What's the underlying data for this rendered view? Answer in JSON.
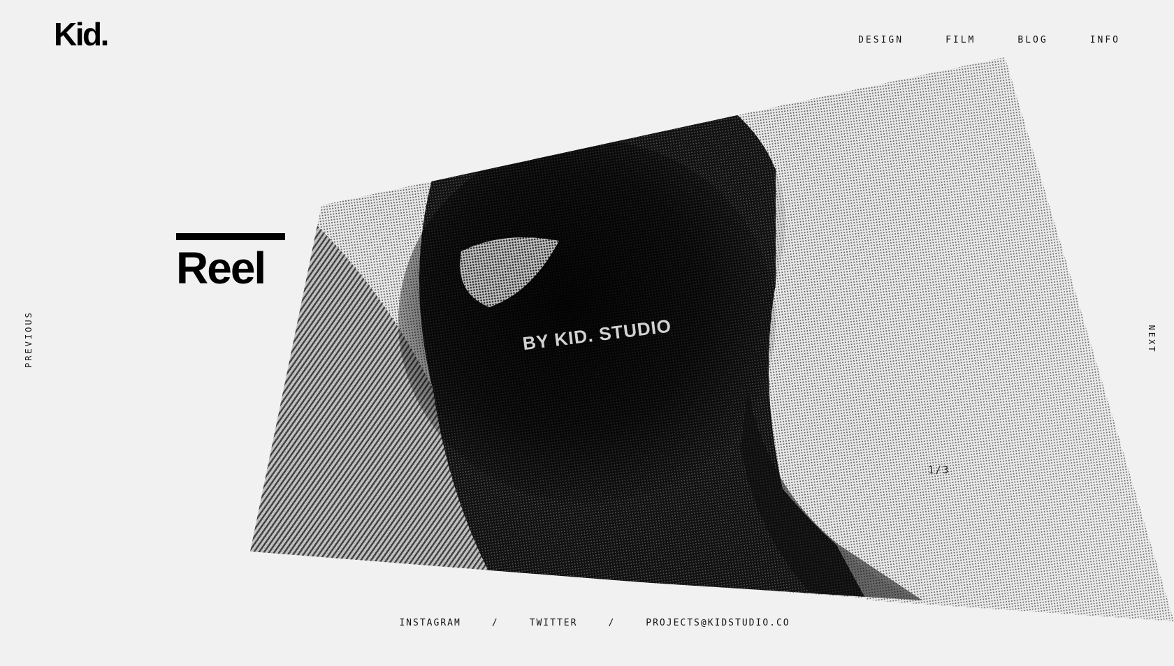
{
  "brand": {
    "logo": "Kid."
  },
  "nav": {
    "items": [
      "DESIGN",
      "FILM",
      "BLOG",
      "INFO"
    ]
  },
  "side": {
    "previous": "PREVIOUS",
    "next": "NEXT"
  },
  "hero": {
    "title": "Reel",
    "overlay_text": "BY KID. STUDIO",
    "counter": "1/3"
  },
  "footer": {
    "links": [
      "INSTAGRAM",
      "TWITTER",
      "PROJECTS@KIDSTUDIO.CO"
    ],
    "separator": "/"
  }
}
